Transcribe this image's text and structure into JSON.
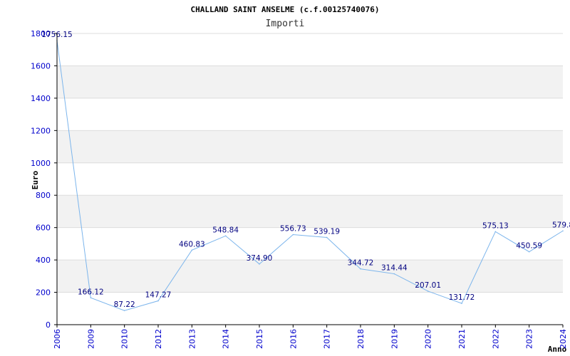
{
  "chart_data": {
    "type": "line",
    "title": "CHALLAND SAINT ANSELME (c.f.00125740076)",
    "subtitle": "Importi",
    "ylabel": "Euro",
    "xlabel": "Anno",
    "categories": [
      "2006",
      "2009",
      "2010",
      "2012",
      "2013",
      "2014",
      "2015",
      "2016",
      "2017",
      "2018",
      "2019",
      "2020",
      "2021",
      "2022",
      "2023",
      "2024"
    ],
    "series": [
      {
        "values": [
          1756.15,
          166.12,
          87.22,
          147.27,
          460.83,
          548.84,
          374.9,
          556.73,
          539.19,
          344.72,
          314.44,
          207.01,
          131.72,
          575.13,
          450.59,
          579.8
        ],
        "labels": [
          "1756.15",
          "166.12",
          "87.22",
          "147.27",
          "460.83",
          "548.84",
          "374.90",
          "556.73",
          "539.19",
          "344.72",
          "314.44",
          "207.01",
          "131.72",
          "575.13",
          "450.59",
          "579.8"
        ]
      }
    ],
    "ylim": [
      0,
      1800
    ],
    "yticks": [
      0,
      200,
      400,
      600,
      800,
      1000,
      1200,
      1400,
      1600,
      1800
    ],
    "grid": true,
    "colors": {
      "line": "#7cb5ec",
      "band": "#f2f2f2",
      "gridline": "#dddddd",
      "axis": "#000000",
      "tick_label": "#0000cc",
      "data_label": "#000080"
    }
  }
}
